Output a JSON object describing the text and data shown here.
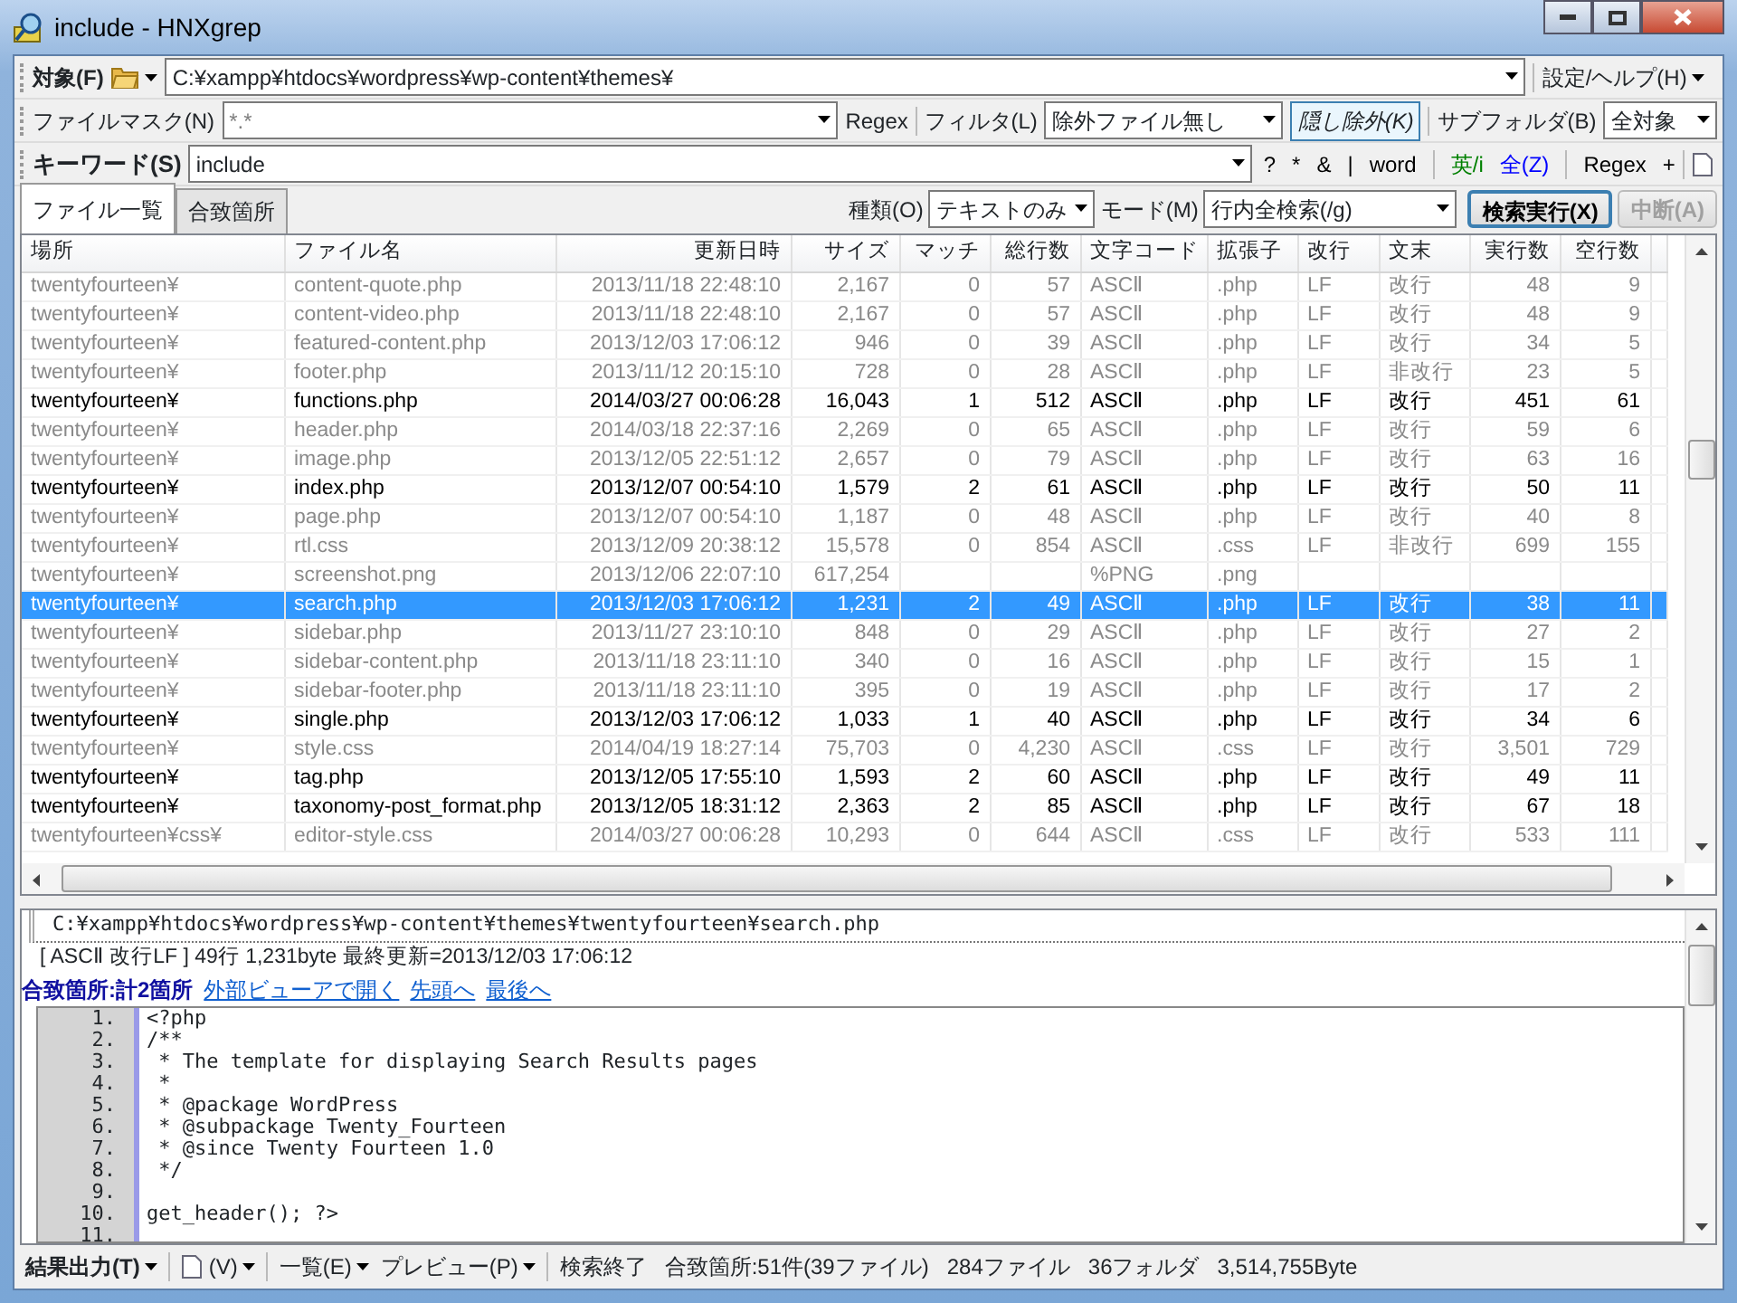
{
  "window": {
    "title": "include - HNXgrep"
  },
  "target": {
    "label": "対象(F)",
    "path": "C:¥xampp¥htdocs¥wordpress¥wp-content¥themes¥",
    "settings_menu": "設定/ヘルプ(H)"
  },
  "file_mask": {
    "label": "ファイルマスク(N)",
    "value": "*.*",
    "regex": "Regex",
    "filter_label": "フィルタ(L)",
    "filter_value": "除外ファイル無し",
    "hidden_exclude": "隠し除外(K)",
    "hidden_exclude_on": true,
    "subfolder_label": "サブフォルダ(B)",
    "subfolder_value": "全対象"
  },
  "keyword": {
    "label": "キーワード(S)",
    "value": "include",
    "options": [
      {
        "text": "?",
        "color": "#000000"
      },
      {
        "text": "*",
        "color": "#000000"
      },
      {
        "text": "&",
        "color": "#000000"
      },
      {
        "text": "|",
        "color": "#000000"
      },
      {
        "text": "word",
        "color": "#000000"
      },
      {
        "text": "英/i",
        "color": "#008000"
      },
      {
        "text": "全(Z)",
        "color": "#0000ff"
      },
      {
        "text": "Regex",
        "color": "#000000"
      },
      {
        "text": "+",
        "color": "#000000"
      }
    ]
  },
  "tabs": [
    {
      "label": "ファイル一覧",
      "selected": true
    },
    {
      "label": "合致箇所",
      "selected": false
    }
  ],
  "search_options": {
    "type_label": "種類(O)",
    "type_value": "テキストのみ",
    "mode_label": "モード(M)",
    "mode_value": "行内全検索(/g)",
    "run_button": "検索実行(X)",
    "stop_button": "中断(A)",
    "stop_disabled": true
  },
  "table": {
    "columns": [
      "場所",
      "ファイル名",
      "更新日時",
      "サイズ",
      "マッチ",
      "総行数",
      "文字コード",
      "拡張子",
      "改行",
      "文末",
      "実行数",
      "空行数"
    ],
    "rows": [
      {
        "location": "twentyfourteen¥",
        "file": "content-quote.php",
        "modified": "2013/11/18 22:48:10",
        "size": "2,167",
        "matches": "0",
        "lines": "57",
        "encoding": "ASCⅡ",
        "ext": ".php",
        "newline": "LF",
        "ending": "改行",
        "code_lines": "48",
        "blank_lines": "9",
        "matched": false,
        "selected": false
      },
      {
        "location": "twentyfourteen¥",
        "file": "content-video.php",
        "modified": "2013/11/18 22:48:10",
        "size": "2,167",
        "matches": "0",
        "lines": "57",
        "encoding": "ASCⅡ",
        "ext": ".php",
        "newline": "LF",
        "ending": "改行",
        "code_lines": "48",
        "blank_lines": "9",
        "matched": false,
        "selected": false
      },
      {
        "location": "twentyfourteen¥",
        "file": "featured-content.php",
        "modified": "2013/12/03 17:06:12",
        "size": "946",
        "matches": "0",
        "lines": "39",
        "encoding": "ASCⅡ",
        "ext": ".php",
        "newline": "LF",
        "ending": "改行",
        "code_lines": "34",
        "blank_lines": "5",
        "matched": false,
        "selected": false
      },
      {
        "location": "twentyfourteen¥",
        "file": "footer.php",
        "modified": "2013/11/12 20:15:10",
        "size": "728",
        "matches": "0",
        "lines": "28",
        "encoding": "ASCⅡ",
        "ext": ".php",
        "newline": "LF",
        "ending": "非改行",
        "code_lines": "23",
        "blank_lines": "5",
        "matched": false,
        "selected": false
      },
      {
        "location": "twentyfourteen¥",
        "file": "functions.php",
        "modified": "2014/03/27 00:06:28",
        "size": "16,043",
        "matches": "1",
        "lines": "512",
        "encoding": "ASCⅡ",
        "ext": ".php",
        "newline": "LF",
        "ending": "改行",
        "code_lines": "451",
        "blank_lines": "61",
        "matched": true,
        "selected": false
      },
      {
        "location": "twentyfourteen¥",
        "file": "header.php",
        "modified": "2014/03/18 22:37:16",
        "size": "2,269",
        "matches": "0",
        "lines": "65",
        "encoding": "ASCⅡ",
        "ext": ".php",
        "newline": "LF",
        "ending": "改行",
        "code_lines": "59",
        "blank_lines": "6",
        "matched": false,
        "selected": false
      },
      {
        "location": "twentyfourteen¥",
        "file": "image.php",
        "modified": "2013/12/05 22:51:12",
        "size": "2,657",
        "matches": "0",
        "lines": "79",
        "encoding": "ASCⅡ",
        "ext": ".php",
        "newline": "LF",
        "ending": "改行",
        "code_lines": "63",
        "blank_lines": "16",
        "matched": false,
        "selected": false
      },
      {
        "location": "twentyfourteen¥",
        "file": "index.php",
        "modified": "2013/12/07 00:54:10",
        "size": "1,579",
        "matches": "2",
        "lines": "61",
        "encoding": "ASCⅡ",
        "ext": ".php",
        "newline": "LF",
        "ending": "改行",
        "code_lines": "50",
        "blank_lines": "11",
        "matched": true,
        "selected": false
      },
      {
        "location": "twentyfourteen¥",
        "file": "page.php",
        "modified": "2013/12/07 00:54:10",
        "size": "1,187",
        "matches": "0",
        "lines": "48",
        "encoding": "ASCⅡ",
        "ext": ".php",
        "newline": "LF",
        "ending": "改行",
        "code_lines": "40",
        "blank_lines": "8",
        "matched": false,
        "selected": false
      },
      {
        "location": "twentyfourteen¥",
        "file": "rtl.css",
        "modified": "2013/12/09 20:38:12",
        "size": "15,578",
        "matches": "0",
        "lines": "854",
        "encoding": "ASCⅡ",
        "ext": ".css",
        "newline": "LF",
        "ending": "非改行",
        "code_lines": "699",
        "blank_lines": "155",
        "matched": false,
        "selected": false
      },
      {
        "location": "twentyfourteen¥",
        "file": "screenshot.png",
        "modified": "2013/12/06 22:07:10",
        "size": "617,254",
        "encoding": "%PNG",
        "ext": ".png",
        "matched": false,
        "selected": false
      },
      {
        "location": "twentyfourteen¥",
        "file": "search.php",
        "modified": "2013/12/03 17:06:12",
        "size": "1,231",
        "matches": "2",
        "lines": "49",
        "encoding": "ASCⅡ",
        "ext": ".php",
        "newline": "LF",
        "ending": "改行",
        "code_lines": "38",
        "blank_lines": "11",
        "matched": true,
        "selected": true
      },
      {
        "location": "twentyfourteen¥",
        "file": "sidebar.php",
        "modified": "2013/11/27 23:10:10",
        "size": "848",
        "matches": "0",
        "lines": "29",
        "encoding": "ASCⅡ",
        "ext": ".php",
        "newline": "LF",
        "ending": "改行",
        "code_lines": "27",
        "blank_lines": "2",
        "matched": false,
        "selected": false
      },
      {
        "location": "twentyfourteen¥",
        "file": "sidebar-content.php",
        "modified": "2013/11/18 23:11:10",
        "size": "340",
        "matches": "0",
        "lines": "16",
        "encoding": "ASCⅡ",
        "ext": ".php",
        "newline": "LF",
        "ending": "改行",
        "code_lines": "15",
        "blank_lines": "1",
        "matched": false,
        "selected": false
      },
      {
        "location": "twentyfourteen¥",
        "file": "sidebar-footer.php",
        "modified": "2013/11/18 23:11:10",
        "size": "395",
        "matches": "0",
        "lines": "19",
        "encoding": "ASCⅡ",
        "ext": ".php",
        "newline": "LF",
        "ending": "改行",
        "code_lines": "17",
        "blank_lines": "2",
        "matched": false,
        "selected": false
      },
      {
        "location": "twentyfourteen¥",
        "file": "single.php",
        "modified": "2013/12/03 17:06:12",
        "size": "1,033",
        "matches": "1",
        "lines": "40",
        "encoding": "ASCⅡ",
        "ext": ".php",
        "newline": "LF",
        "ending": "改行",
        "code_lines": "34",
        "blank_lines": "6",
        "matched": true,
        "selected": false
      },
      {
        "location": "twentyfourteen¥",
        "file": "style.css",
        "modified": "2014/04/19 18:27:14",
        "size": "75,703",
        "matches": "0",
        "lines": "4,230",
        "encoding": "ASCⅡ",
        "ext": ".css",
        "newline": "LF",
        "ending": "改行",
        "code_lines": "3,501",
        "blank_lines": "729",
        "matched": false,
        "selected": false
      },
      {
        "location": "twentyfourteen¥",
        "file": "tag.php",
        "modified": "2013/12/05 17:55:10",
        "size": "1,593",
        "matches": "2",
        "lines": "60",
        "encoding": "ASCⅡ",
        "ext": ".php",
        "newline": "LF",
        "ending": "改行",
        "code_lines": "49",
        "blank_lines": "11",
        "matched": true,
        "selected": false
      },
      {
        "location": "twentyfourteen¥",
        "file": "taxonomy-post_format.php",
        "modified": "2013/12/05 18:31:12",
        "size": "2,363",
        "matches": "2",
        "lines": "85",
        "encoding": "ASCⅡ",
        "ext": ".php",
        "newline": "LF",
        "ending": "改行",
        "code_lines": "67",
        "blank_lines": "18",
        "matched": true,
        "selected": false
      },
      {
        "location": "twentyfourteen¥css¥",
        "file": "editor-style.css",
        "modified": "2014/03/27 00:06:28",
        "size": "10,293",
        "matches": "0",
        "lines": "644",
        "encoding": "ASCⅡ",
        "ext": ".css",
        "newline": "LF",
        "ending": "改行",
        "code_lines": "533",
        "blank_lines": "111",
        "matched": false,
        "selected": false
      }
    ]
  },
  "preview": {
    "path": "C:¥xampp¥htdocs¥wordpress¥wp-content¥themes¥twentyfourteen¥search.php",
    "info": "[ ASCⅡ 改行LF ] 49行 1,231byte 最終更新=2013/12/03 17:06:12",
    "match_summary": "合致箇所:計2箇所",
    "links": [
      "外部ビューアで開く",
      "先頭へ",
      "最後へ"
    ],
    "lines": [
      {
        "number": "1.",
        "text": "<?php"
      },
      {
        "number": "2.",
        "text": "/**"
      },
      {
        "number": "3.",
        "text": " * The template for displaying Search Results pages"
      },
      {
        "number": "4.",
        "text": " *"
      },
      {
        "number": "5.",
        "text": " * @package WordPress"
      },
      {
        "number": "6.",
        "text": " * @subpackage Twenty_Fourteen"
      },
      {
        "number": "7.",
        "text": " * @since Twenty Fourteen 1.0"
      },
      {
        "number": "8.",
        "text": " */"
      },
      {
        "number": "9."
      },
      {
        "number": "10.",
        "text": "get_header(); ?>"
      },
      {
        "number": "11."
      }
    ]
  },
  "status_bar": {
    "output_menu": "結果出力(T)",
    "view_menu": "(V)",
    "list_menu": "一覧(E)",
    "preview_menu": "プレビュー(P)",
    "items": [
      "検索終了",
      "合致箇所:51件(39ファイル)",
      "284ファイル",
      "36フォルダ",
      "3,514,755Byte"
    ]
  }
}
